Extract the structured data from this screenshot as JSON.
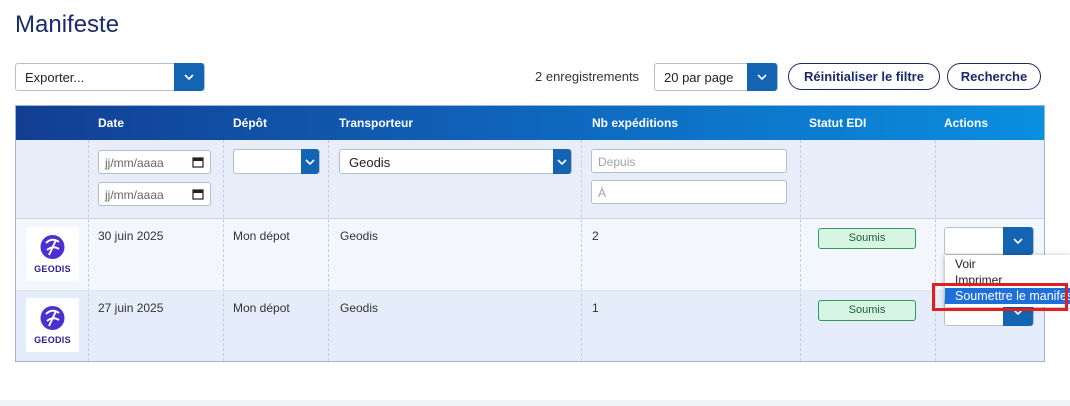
{
  "page": {
    "title": "Manifeste"
  },
  "toolbar": {
    "export_select": "Exporter...",
    "record_count": "2 enregistrements",
    "per_page": "20 par page",
    "reset_filter": "Réinitialiser le filtre",
    "search": "Recherche"
  },
  "table": {
    "headers": [
      "Date",
      "Dépôt",
      "Transporteur",
      "Nb expéditions",
      "Statut EDI",
      "Actions"
    ],
    "filters": {
      "date_from_placeholder": "jj/mm/aaaa",
      "date_to_placeholder": "jj/mm/aaaa",
      "depot_value": "",
      "carrier_value": "Geodis",
      "nb_from_placeholder": "Depuis",
      "nb_to_placeholder": "À"
    },
    "rows": [
      {
        "logo": "GEODIS",
        "date": "30 juin 2025",
        "depot": "Mon dépot",
        "carrier": "Geodis",
        "shipments": "2",
        "status": "Soumis"
      },
      {
        "logo": "GEODIS",
        "date": "27 juin 2025",
        "depot": "Mon dépot",
        "carrier": "Geodis",
        "shipments": "1",
        "status": "Soumis"
      }
    ]
  },
  "actions_menu": {
    "items": [
      "Voir",
      "Imprimer",
      "Soumettre le manifeste"
    ],
    "selected_index": 2
  },
  "colors": {
    "brand_blue": "#1464b4",
    "title_navy": "#1a2b6b",
    "status_green": "#2e9b5c",
    "highlight_red": "#e02020",
    "geodis_purple": "#4b2fd1"
  }
}
